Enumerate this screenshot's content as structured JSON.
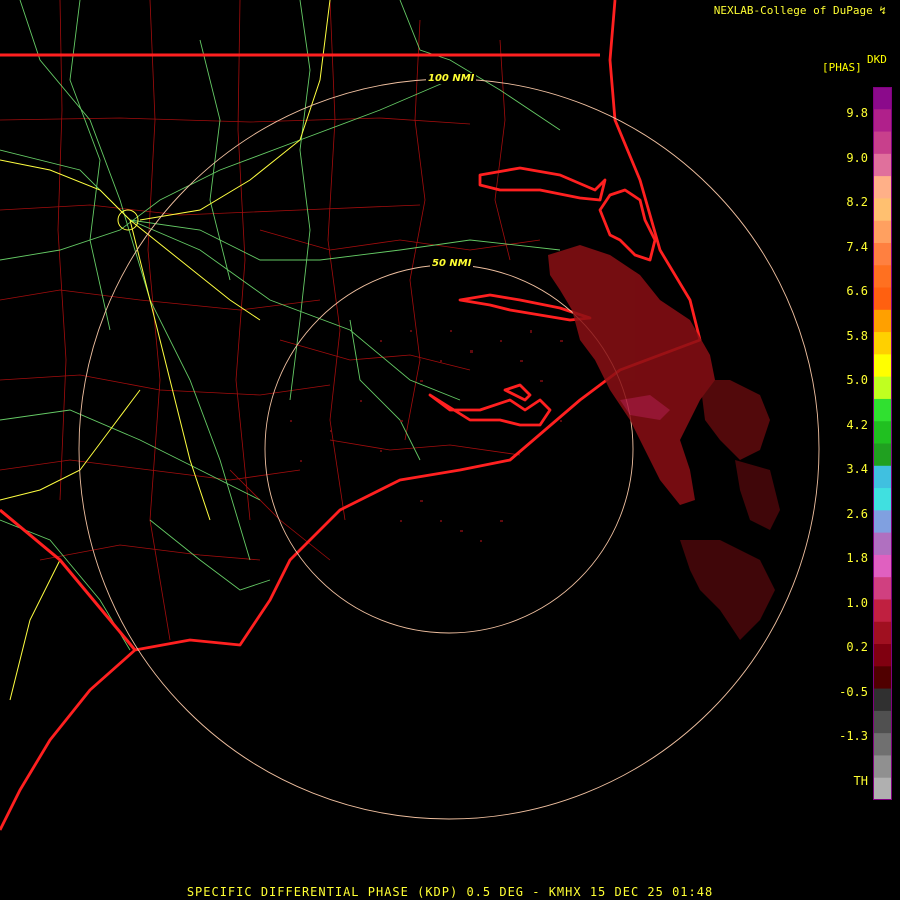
{
  "credit": "NEXLAB-College of DuPage",
  "credit_logo_glyph": "↯",
  "product_code": "DKD",
  "units": "[PHAS]",
  "footer": "SPECIFIC DIFFERENTIAL PHASE (KDP) 0.5 DEG - KMHX 15 DEC 25 01:48",
  "range_rings": [
    "50 NMI",
    "100 NMI"
  ],
  "legend": {
    "ticks": [
      "9.8",
      "9.0",
      "8.2",
      "7.4",
      "6.6",
      "5.8",
      "5.0",
      "4.2",
      "3.4",
      "2.6",
      "1.8",
      "1.0",
      "0.2",
      "-0.5",
      "-1.3",
      "TH"
    ],
    "colors": [
      "#8b0a8b",
      "#b0208b",
      "#c8408c",
      "#e0709c",
      "#ffb088",
      "#ffc070",
      "#ffa060",
      "#ff8040",
      "#ff7020",
      "#ff6010",
      "#ffa000",
      "#ffd000",
      "#ffff00",
      "#c0ff20",
      "#30e030",
      "#20c020",
      "#20a020",
      "#40c0e0",
      "#40e0e0",
      "#80a0e0",
      "#b070c0",
      "#e060c0",
      "#d04080",
      "#c02040",
      "#a01020",
      "#800010",
      "#500000",
      "#303030",
      "#505050",
      "#707070",
      "#909090",
      "#b0b0b0"
    ]
  },
  "colors": {
    "state_border": "#ff2020",
    "county": "#c01010",
    "highway": "#70e070",
    "interstate": "#ffff40",
    "ring": "#f0c0a0",
    "echo": "#8a0f14"
  }
}
